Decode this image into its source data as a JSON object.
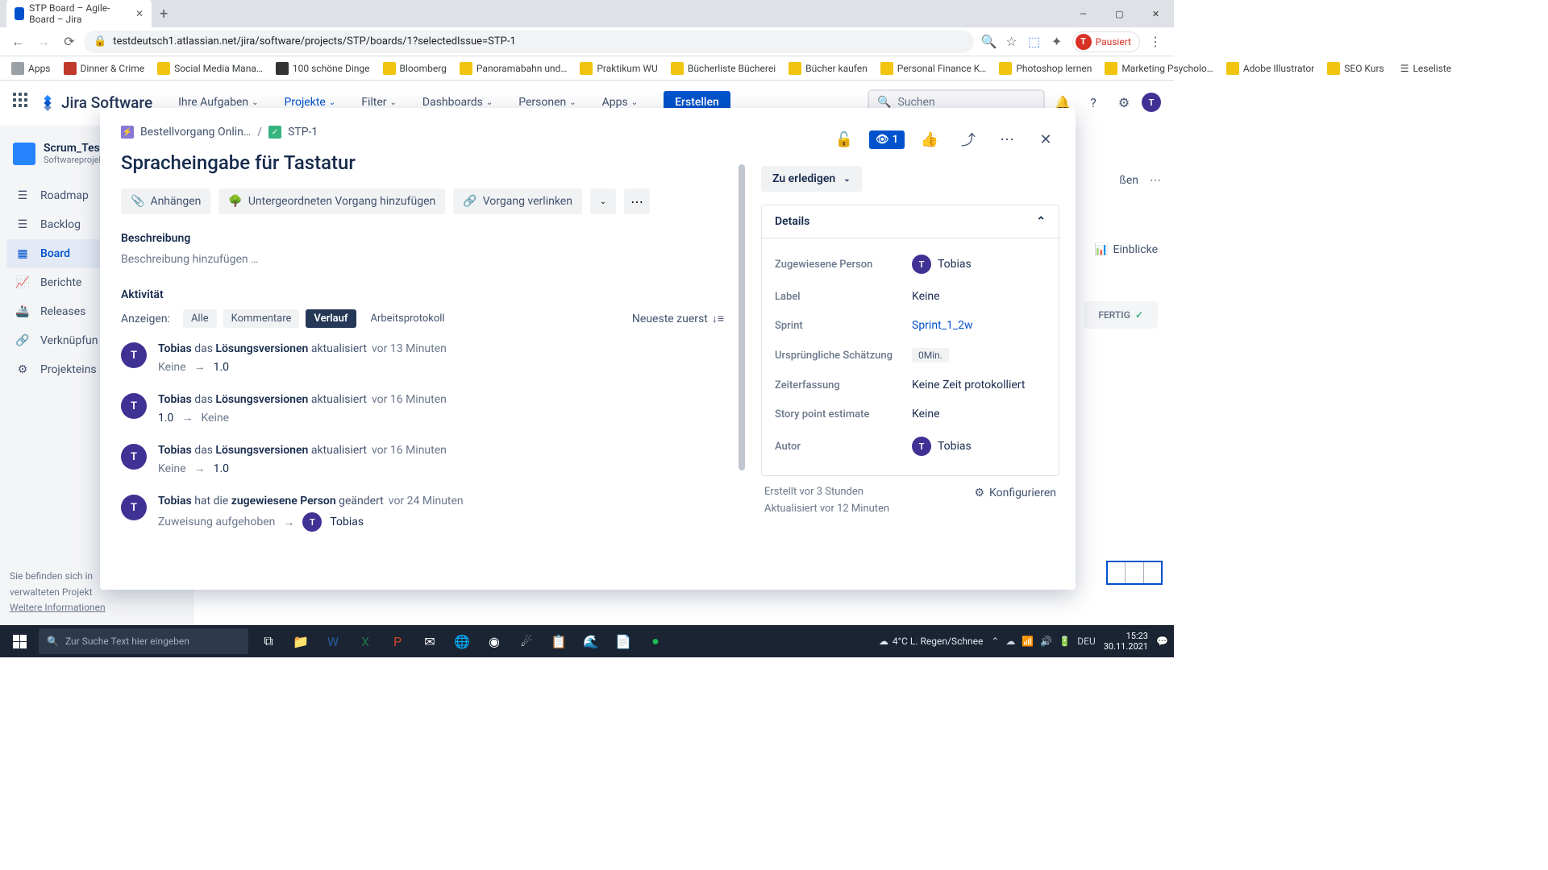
{
  "browser": {
    "tab_title": "STP Board – Agile-Board – Jira",
    "url": "testdeutsch1.atlassian.net/jira/software/projects/STP/boards/1?selectedIssue=STP-1",
    "paused_label": "Pausiert"
  },
  "bookmarks": {
    "apps": "Apps",
    "items": [
      "Dinner & Crime",
      "Social Media Mana…",
      "100 schöne Dinge",
      "Bloomberg",
      "Panoramabahn und…",
      "Praktikum WU",
      "Bücherliste Bücherei",
      "Bücher kaufen",
      "Personal Finance K…",
      "Photoshop lernen",
      "Marketing Psycholo…",
      "Adobe Illustrator",
      "SEO Kurs"
    ],
    "reading_list": "Leseliste"
  },
  "nav": {
    "logo": "Jira Software",
    "items": [
      "Ihre Aufgaben",
      "Projekte",
      "Filter",
      "Dashboards",
      "Personen",
      "Apps"
    ],
    "create": "Erstellen",
    "search_ph": "Suchen"
  },
  "sidebar": {
    "project": "Scrum_Test",
    "project_sub": "Softwareprojek",
    "items": [
      "Roadmap",
      "Backlog",
      "Board",
      "Berichte",
      "Releases",
      "Verknüpfun",
      "Projekteins"
    ],
    "footer1": "Sie befinden sich in",
    "footer2": "verwalteten Projekt",
    "footer_link": "Weitere Informationen"
  },
  "board": {
    "close_sprint": "ßen",
    "insights": "Einblicke",
    "col_done": "FERTIG"
  },
  "issue": {
    "epic": "Bestellvorgang Onlin…",
    "key": "STP-1",
    "title": "Spracheingabe für Tastatur",
    "watch_count": "1",
    "attach": "Anhängen",
    "add_child": "Untergeordneten Vorgang hinzufügen",
    "link": "Vorgang verlinken",
    "desc_label": "Beschreibung",
    "desc_ph": "Beschreibung hinzufügen …",
    "activity_label": "Aktivität",
    "show_label": "Anzeigen:",
    "tabs": [
      "Alle",
      "Kommentare",
      "Verlauf",
      "Arbeitsprotokoll"
    ],
    "sort_label": "Neueste zuerst",
    "status": "Zu erledigen"
  },
  "history": [
    {
      "who": "Tobias",
      "txt1": "das",
      "field": "Lösungsversionen",
      "txt2": "aktualisiert",
      "when": "vor 13 Minuten",
      "from": "Keine",
      "to": "1.0"
    },
    {
      "who": "Tobias",
      "txt1": "das",
      "field": "Lösungsversionen",
      "txt2": "aktualisiert",
      "when": "vor 16 Minuten",
      "from": "1.0",
      "to": "Keine"
    },
    {
      "who": "Tobias",
      "txt1": "das",
      "field": "Lösungsversionen",
      "txt2": "aktualisiert",
      "when": "vor 16 Minuten",
      "from": "Keine",
      "to": "1.0"
    },
    {
      "who": "Tobias",
      "txt1": "hat die",
      "field": "zugewiesene Person",
      "txt2": "geändert",
      "when": "vor 24 Minuten",
      "from": "Zuweisung aufgehoben",
      "to_user": "Tobias"
    }
  ],
  "details": {
    "header": "Details",
    "assignee_lbl": "Zugewiesene Person",
    "assignee": "Tobias",
    "label_lbl": "Label",
    "label_val": "Keine",
    "sprint_lbl": "Sprint",
    "sprint_val": "Sprint_1_2w",
    "est_lbl": "Ursprüngliche Schätzung",
    "est_val": "0Min.",
    "time_lbl": "Zeiterfassung",
    "time_val": "Keine Zeit protokolliert",
    "sp_lbl": "Story point estimate",
    "sp_val": "Keine",
    "author_lbl": "Autor",
    "author_val": "Tobias",
    "created": "Erstellt vor 3 Stunden",
    "updated": "Aktualisiert vor 12 Minuten",
    "configure": "Konfigurieren"
  },
  "taskbar": {
    "search_ph": "Zur Suche Text hier eingeben",
    "weather": "4°C  L. Regen/Schnee",
    "lang": "DEU",
    "time": "15:23",
    "date": "30.11.2021"
  }
}
